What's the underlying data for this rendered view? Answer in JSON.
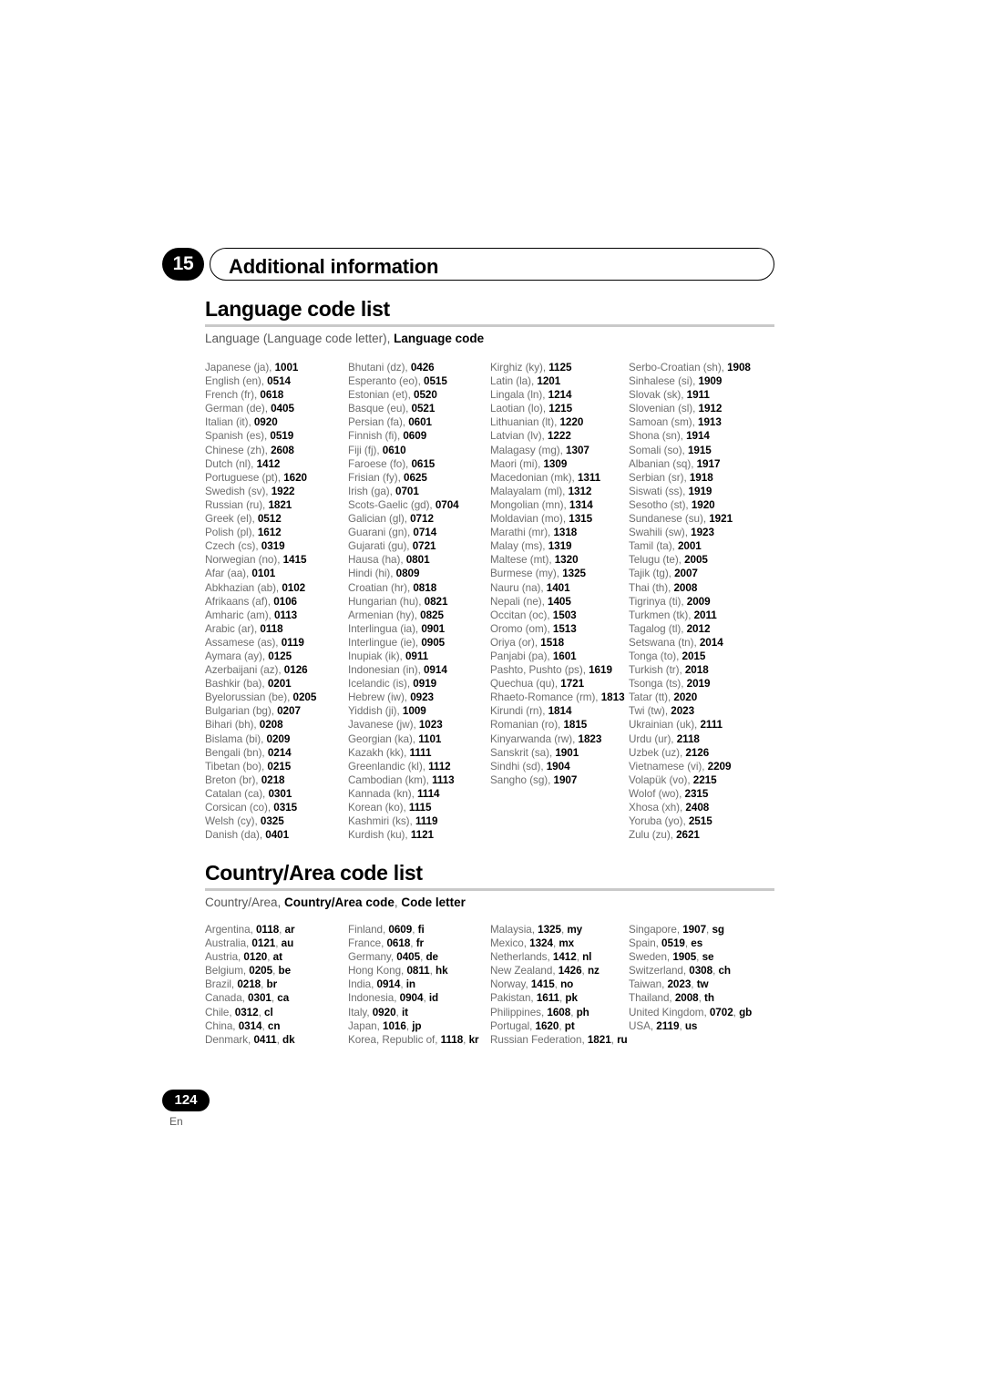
{
  "chapter": {
    "number": "15",
    "title": "Additional information"
  },
  "language_section": {
    "heading": "Language code list",
    "legend_plain_1": "Language (Language code letter), ",
    "legend_bold": "Language code",
    "columns": [
      [
        {
          "name": "Japanese (ja), ",
          "code": "1001"
        },
        {
          "name": "English (en), ",
          "code": "0514"
        },
        {
          "name": "French (fr), ",
          "code": "0618"
        },
        {
          "name": "German (de), ",
          "code": "0405"
        },
        {
          "name": "Italian (it), ",
          "code": "0920"
        },
        {
          "name": "Spanish (es), ",
          "code": "0519"
        },
        {
          "name": "Chinese (zh), ",
          "code": "2608"
        },
        {
          "name": "Dutch (nl), ",
          "code": "1412"
        },
        {
          "name": "Portuguese (pt), ",
          "code": "1620"
        },
        {
          "name": "Swedish (sv), ",
          "code": "1922"
        },
        {
          "name": "Russian (ru), ",
          "code": "1821"
        },
        {
          "name": "Greek (el), ",
          "code": "0512"
        },
        {
          "name": "Polish (pl), ",
          "code": "1612"
        },
        {
          "name": "Czech (cs), ",
          "code": "0319"
        },
        {
          "name": "Norwegian (no), ",
          "code": "1415"
        },
        {
          "name": "Afar (aa), ",
          "code": "0101"
        },
        {
          "name": "Abkhazian (ab), ",
          "code": "0102"
        },
        {
          "name": "Afrikaans (af), ",
          "code": "0106"
        },
        {
          "name": "Amharic (am), ",
          "code": "0113"
        },
        {
          "name": "Arabic (ar), ",
          "code": "0118"
        },
        {
          "name": "Assamese (as), ",
          "code": "0119"
        },
        {
          "name": "Aymara (ay), ",
          "code": "0125"
        },
        {
          "name": "Azerbaijani (az), ",
          "code": "0126"
        },
        {
          "name": "Bashkir (ba), ",
          "code": "0201"
        },
        {
          "name": "Byelorussian (be), ",
          "code": "0205"
        },
        {
          "name": "Bulgarian (bg), ",
          "code": "0207"
        },
        {
          "name": "Bihari (bh), ",
          "code": "0208"
        },
        {
          "name": "Bislama (bi), ",
          "code": "0209"
        },
        {
          "name": "Bengali (bn), ",
          "code": "0214"
        },
        {
          "name": "Tibetan (bo), ",
          "code": "0215"
        },
        {
          "name": "Breton (br), ",
          "code": "0218"
        },
        {
          "name": "Catalan (ca), ",
          "code": "0301"
        },
        {
          "name": "Corsican (co), ",
          "code": "0315"
        },
        {
          "name": "Welsh (cy), ",
          "code": "0325"
        },
        {
          "name": "Danish (da), ",
          "code": "0401"
        }
      ],
      [
        {
          "name": "Bhutani (dz), ",
          "code": "0426"
        },
        {
          "name": "Esperanto (eo), ",
          "code": "0515"
        },
        {
          "name": "Estonian (et), ",
          "code": "0520"
        },
        {
          "name": "Basque (eu), ",
          "code": "0521"
        },
        {
          "name": "Persian (fa), ",
          "code": "0601"
        },
        {
          "name": "Finnish (fi), ",
          "code": "0609"
        },
        {
          "name": "Fiji (fj), ",
          "code": "0610"
        },
        {
          "name": "Faroese (fo), ",
          "code": "0615"
        },
        {
          "name": "Frisian (fy), ",
          "code": "0625"
        },
        {
          "name": "Irish (ga), ",
          "code": "0701"
        },
        {
          "name": "Scots-Gaelic (gd), ",
          "code": "0704"
        },
        {
          "name": "Galician (gl), ",
          "code": "0712"
        },
        {
          "name": "Guarani (gn), ",
          "code": "0714"
        },
        {
          "name": "Gujarati (gu), ",
          "code": "0721"
        },
        {
          "name": "Hausa (ha), ",
          "code": "0801"
        },
        {
          "name": "Hindi (hi), ",
          "code": "0809"
        },
        {
          "name": "Croatian (hr), ",
          "code": "0818"
        },
        {
          "name": "Hungarian (hu), ",
          "code": "0821"
        },
        {
          "name": "Armenian (hy), ",
          "code": "0825"
        },
        {
          "name": "Interlingua (ia), ",
          "code": "0901"
        },
        {
          "name": "Interlingue (ie), ",
          "code": "0905"
        },
        {
          "name": "Inupiak (ik), ",
          "code": "0911"
        },
        {
          "name": "Indonesian (in), ",
          "code": "0914"
        },
        {
          "name": "Icelandic (is), ",
          "code": "0919"
        },
        {
          "name": "Hebrew (iw), ",
          "code": "0923"
        },
        {
          "name": "Yiddish (ji), ",
          "code": "1009"
        },
        {
          "name": "Javanese (jw), ",
          "code": "1023"
        },
        {
          "name": "Georgian (ka), ",
          "code": "1101"
        },
        {
          "name": "Kazakh (kk), ",
          "code": "1111"
        },
        {
          "name": "Greenlandic (kl), ",
          "code": "1112"
        },
        {
          "name": "Cambodian (km), ",
          "code": "1113"
        },
        {
          "name": "Kannada (kn), ",
          "code": "1114"
        },
        {
          "name": "Korean (ko), ",
          "code": "1115"
        },
        {
          "name": "Kashmiri (ks), ",
          "code": "1119"
        },
        {
          "name": "Kurdish (ku), ",
          "code": "1121"
        }
      ],
      [
        {
          "name": "Kirghiz (ky), ",
          "code": "1125"
        },
        {
          "name": "Latin (la), ",
          "code": "1201"
        },
        {
          "name": "Lingala (ln), ",
          "code": "1214"
        },
        {
          "name": "Laotian (lo), ",
          "code": "1215"
        },
        {
          "name": "Lithuanian (lt), ",
          "code": "1220"
        },
        {
          "name": "Latvian (lv), ",
          "code": "1222"
        },
        {
          "name": "Malagasy (mg), ",
          "code": "1307"
        },
        {
          "name": "Maori (mi), ",
          "code": "1309"
        },
        {
          "name": "Macedonian (mk), ",
          "code": "1311"
        },
        {
          "name": "Malayalam (ml), ",
          "code": "1312"
        },
        {
          "name": "Mongolian (mn), ",
          "code": "1314"
        },
        {
          "name": "Moldavian (mo), ",
          "code": "1315"
        },
        {
          "name": "Marathi (mr), ",
          "code": "1318"
        },
        {
          "name": "Malay (ms), ",
          "code": "1319"
        },
        {
          "name": "Maltese (mt), ",
          "code": "1320"
        },
        {
          "name": "Burmese (my), ",
          "code": "1325"
        },
        {
          "name": "Nauru (na), ",
          "code": "1401"
        },
        {
          "name": "Nepali (ne), ",
          "code": "1405"
        },
        {
          "name": "Occitan (oc), ",
          "code": "1503"
        },
        {
          "name": "Oromo (om), ",
          "code": "1513"
        },
        {
          "name": "Oriya (or), ",
          "code": "1518"
        },
        {
          "name": "Panjabi (pa), ",
          "code": "1601"
        },
        {
          "name": "Pashto, Pushto (ps), ",
          "code": "1619"
        },
        {
          "name": "Quechua (qu), ",
          "code": "1721"
        },
        {
          "name": "Rhaeto-Romance (rm), ",
          "code": "1813",
          "wrap": true
        },
        {
          "name": "Kirundi (rn), ",
          "code": "1814"
        },
        {
          "name": "Romanian (ro), ",
          "code": "1815"
        },
        {
          "name": "Kinyarwanda (rw), ",
          "code": "1823"
        },
        {
          "name": "Sanskrit (sa), ",
          "code": "1901"
        },
        {
          "name": "Sindhi (sd), ",
          "code": "1904"
        },
        {
          "name": "Sangho (sg), ",
          "code": "1907"
        }
      ],
      [
        {
          "name": "Serbo-Croatian (sh), ",
          "code": "1908"
        },
        {
          "name": "Sinhalese (si), ",
          "code": "1909"
        },
        {
          "name": "Slovak (sk), ",
          "code": "1911"
        },
        {
          "name": "Slovenian (sl), ",
          "code": "1912"
        },
        {
          "name": "Samoan (sm), ",
          "code": "1913"
        },
        {
          "name": "Shona (sn), ",
          "code": "1914"
        },
        {
          "name": "Somali (so), ",
          "code": "1915"
        },
        {
          "name": "Albanian (sq), ",
          "code": "1917"
        },
        {
          "name": "Serbian (sr), ",
          "code": "1918"
        },
        {
          "name": "Siswati (ss), ",
          "code": "1919"
        },
        {
          "name": "Sesotho (st), ",
          "code": "1920"
        },
        {
          "name": "Sundanese (su), ",
          "code": "1921"
        },
        {
          "name": "Swahili (sw), ",
          "code": "1923"
        },
        {
          "name": "Tamil (ta), ",
          "code": "2001"
        },
        {
          "name": "Telugu (te), ",
          "code": "2005"
        },
        {
          "name": "Tajik (tg), ",
          "code": "2007"
        },
        {
          "name": "Thai (th), ",
          "code": "2008"
        },
        {
          "name": "Tigrinya (ti), ",
          "code": "2009"
        },
        {
          "name": "Turkmen (tk), ",
          "code": "2011"
        },
        {
          "name": "Tagalog (tl), ",
          "code": "2012"
        },
        {
          "name": "Setswana (tn), ",
          "code": "2014"
        },
        {
          "name": "Tonga (to), ",
          "code": "2015"
        },
        {
          "name": "Turkish (tr), ",
          "code": "2018"
        },
        {
          "name": "Tsonga (ts), ",
          "code": "2019"
        },
        {
          "name": "Tatar (tt), ",
          "code": "2020"
        },
        {
          "name": "Twi (tw), ",
          "code": "2023"
        },
        {
          "name": "Ukrainian (uk), ",
          "code": "2111"
        },
        {
          "name": "Urdu (ur), ",
          "code": "2118"
        },
        {
          "name": "Uzbek (uz), ",
          "code": "2126"
        },
        {
          "name": "Vietnamese (vi), ",
          "code": "2209"
        },
        {
          "name": "Volapük (vo), ",
          "code": "2215"
        },
        {
          "name": "Wolof (wo), ",
          "code": "2315"
        },
        {
          "name": "Xhosa (xh), ",
          "code": "2408"
        },
        {
          "name": "Yoruba (yo), ",
          "code": "2515"
        },
        {
          "name": "Zulu (zu), ",
          "code": "2621"
        }
      ]
    ]
  },
  "country_section": {
    "heading": "Country/Area code list",
    "legend_plain_1": "Country/Area, ",
    "legend_bold_1": "Country/Area code",
    "legend_plain_2": ", ",
    "legend_bold_2": "Code letter",
    "columns": [
      [
        {
          "name": "Argentina, ",
          "code": "0118",
          "letter": "ar"
        },
        {
          "name": "Australia, ",
          "code": "0121",
          "letter": "au"
        },
        {
          "name": "Austria, ",
          "code": "0120",
          "letter": "at"
        },
        {
          "name": "Belgium, ",
          "code": "0205",
          "letter": "be"
        },
        {
          "name": "Brazil, ",
          "code": "0218",
          "letter": "br"
        },
        {
          "name": "Canada, ",
          "code": "0301",
          "letter": "ca"
        },
        {
          "name": "Chile, ",
          "code": "0312",
          "letter": "cl"
        },
        {
          "name": "China, ",
          "code": "0314",
          "letter": "cn"
        },
        {
          "name": "Denmark, ",
          "code": "0411",
          "letter": "dk"
        }
      ],
      [
        {
          "name": "Finland, ",
          "code": "0609",
          "letter": "fi"
        },
        {
          "name": "France, ",
          "code": "0618",
          "letter": "fr"
        },
        {
          "name": "Germany, ",
          "code": "0405",
          "letter": "de"
        },
        {
          "name": "Hong Kong, ",
          "code": "0811",
          "letter": "hk"
        },
        {
          "name": "India, ",
          "code": "0914",
          "letter": "in"
        },
        {
          "name": "Indonesia, ",
          "code": "0904",
          "letter": "id"
        },
        {
          "name": "Italy, ",
          "code": "0920",
          "letter": "it"
        },
        {
          "name": "Japan, ",
          "code": "1016",
          "letter": "jp"
        },
        {
          "name": "Korea, Republic of, ",
          "code": "1118",
          "letter": "kr"
        }
      ],
      [
        {
          "name": "Malaysia, ",
          "code": "1325",
          "letter": "my"
        },
        {
          "name": "Mexico, ",
          "code": "1324",
          "letter": "mx"
        },
        {
          "name": "Netherlands, ",
          "code": "1412",
          "letter": "nl"
        },
        {
          "name": "New Zealand, ",
          "code": "1426",
          "letter": "nz"
        },
        {
          "name": "Norway, ",
          "code": "1415",
          "letter": "no"
        },
        {
          "name": "Pakistan, ",
          "code": "1611",
          "letter": "pk"
        },
        {
          "name": "Philippines, ",
          "code": "1608",
          "letter": "ph"
        },
        {
          "name": "Portugal, ",
          "code": "1620",
          "letter": "pt"
        },
        {
          "name": "Russian Federation, ",
          "code": "1821",
          "letter": "ru"
        }
      ],
      [
        {
          "name": "Singapore, ",
          "code": "1907",
          "letter": "sg"
        },
        {
          "name": "Spain, ",
          "code": "0519",
          "letter": "es"
        },
        {
          "name": "Sweden, ",
          "code": "1905",
          "letter": "se"
        },
        {
          "name": "Switzerland, ",
          "code": "0308",
          "letter": "ch"
        },
        {
          "name": "Taiwan, ",
          "code": "2023",
          "letter": "tw"
        },
        {
          "name": "Thailand, ",
          "code": "2008",
          "letter": "th"
        },
        {
          "name": "United Kingdom, ",
          "code": "0702",
          "letter": "gb"
        },
        {
          "name": "USA, ",
          "code": "2119",
          "letter": "us"
        }
      ]
    ]
  },
  "footer": {
    "page_number": "124",
    "language_code": "En"
  }
}
